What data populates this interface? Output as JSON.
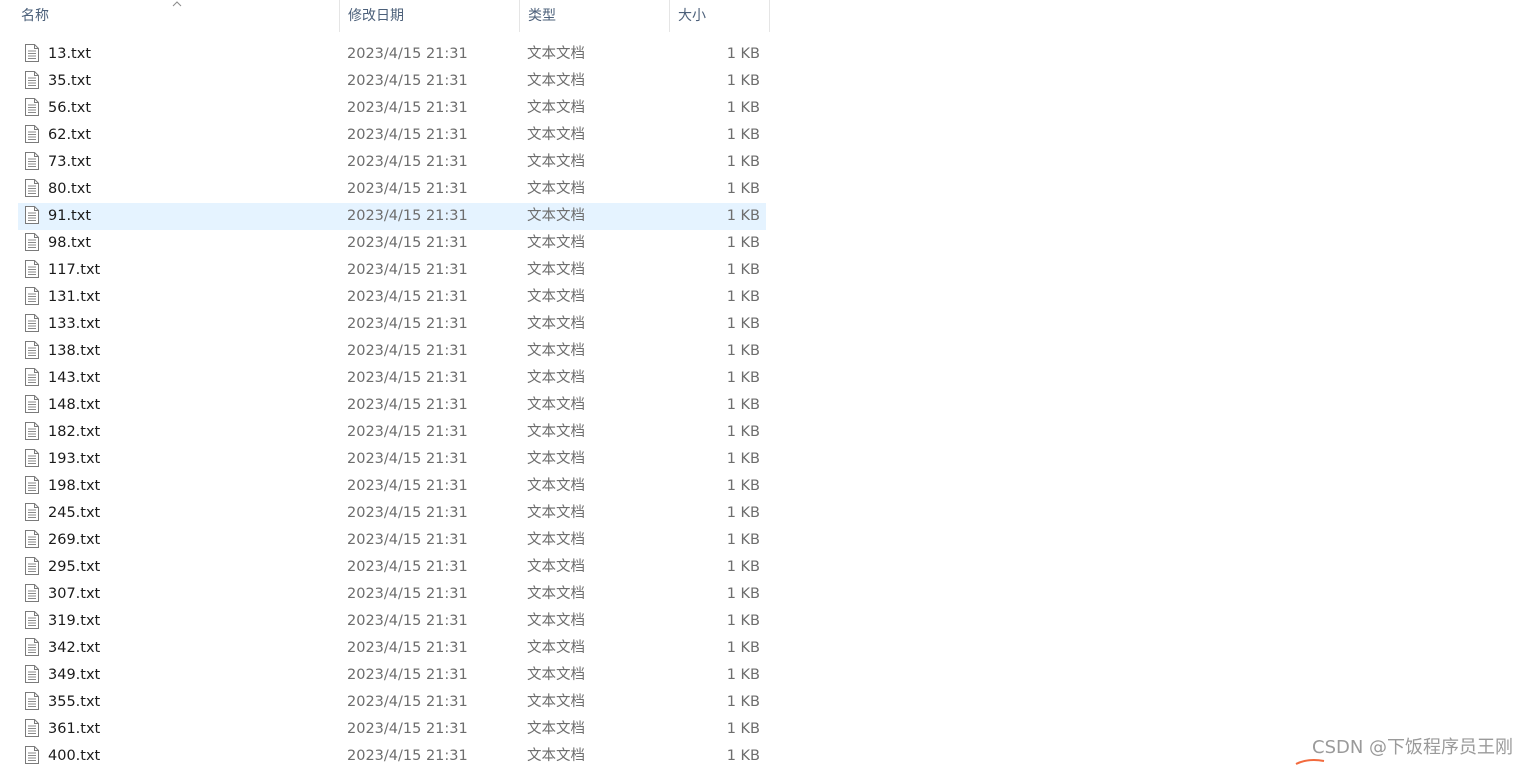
{
  "columns": {
    "name": "名称",
    "date": "修改日期",
    "type": "类型",
    "size": "大小"
  },
  "files": [
    {
      "name": "13.txt",
      "date": "2023/4/15 21:31",
      "type": "文本文档",
      "size": "1 KB"
    },
    {
      "name": "35.txt",
      "date": "2023/4/15 21:31",
      "type": "文本文档",
      "size": "1 KB"
    },
    {
      "name": "56.txt",
      "date": "2023/4/15 21:31",
      "type": "文本文档",
      "size": "1 KB"
    },
    {
      "name": "62.txt",
      "date": "2023/4/15 21:31",
      "type": "文本文档",
      "size": "1 KB"
    },
    {
      "name": "73.txt",
      "date": "2023/4/15 21:31",
      "type": "文本文档",
      "size": "1 KB"
    },
    {
      "name": "80.txt",
      "date": "2023/4/15 21:31",
      "type": "文本文档",
      "size": "1 KB"
    },
    {
      "name": "91.txt",
      "date": "2023/4/15 21:31",
      "type": "文本文档",
      "size": "1 KB",
      "selected": true
    },
    {
      "name": "98.txt",
      "date": "2023/4/15 21:31",
      "type": "文本文档",
      "size": "1 KB"
    },
    {
      "name": "117.txt",
      "date": "2023/4/15 21:31",
      "type": "文本文档",
      "size": "1 KB"
    },
    {
      "name": "131.txt",
      "date": "2023/4/15 21:31",
      "type": "文本文档",
      "size": "1 KB"
    },
    {
      "name": "133.txt",
      "date": "2023/4/15 21:31",
      "type": "文本文档",
      "size": "1 KB"
    },
    {
      "name": "138.txt",
      "date": "2023/4/15 21:31",
      "type": "文本文档",
      "size": "1 KB"
    },
    {
      "name": "143.txt",
      "date": "2023/4/15 21:31",
      "type": "文本文档",
      "size": "1 KB"
    },
    {
      "name": "148.txt",
      "date": "2023/4/15 21:31",
      "type": "文本文档",
      "size": "1 KB"
    },
    {
      "name": "182.txt",
      "date": "2023/4/15 21:31",
      "type": "文本文档",
      "size": "1 KB"
    },
    {
      "name": "193.txt",
      "date": "2023/4/15 21:31",
      "type": "文本文档",
      "size": "1 KB"
    },
    {
      "name": "198.txt",
      "date": "2023/4/15 21:31",
      "type": "文本文档",
      "size": "1 KB"
    },
    {
      "name": "245.txt",
      "date": "2023/4/15 21:31",
      "type": "文本文档",
      "size": "1 KB"
    },
    {
      "name": "269.txt",
      "date": "2023/4/15 21:31",
      "type": "文本文档",
      "size": "1 KB"
    },
    {
      "name": "295.txt",
      "date": "2023/4/15 21:31",
      "type": "文本文档",
      "size": "1 KB"
    },
    {
      "name": "307.txt",
      "date": "2023/4/15 21:31",
      "type": "文本文档",
      "size": "1 KB"
    },
    {
      "name": "319.txt",
      "date": "2023/4/15 21:31",
      "type": "文本文档",
      "size": "1 KB"
    },
    {
      "name": "342.txt",
      "date": "2023/4/15 21:31",
      "type": "文本文档",
      "size": "1 KB"
    },
    {
      "name": "349.txt",
      "date": "2023/4/15 21:31",
      "type": "文本文档",
      "size": "1 KB"
    },
    {
      "name": "355.txt",
      "date": "2023/4/15 21:31",
      "type": "文本文档",
      "size": "1 KB"
    },
    {
      "name": "361.txt",
      "date": "2023/4/15 21:31",
      "type": "文本文档",
      "size": "1 KB"
    },
    {
      "name": "400.txt",
      "date": "2023/4/15 21:31",
      "type": "文本文档",
      "size": "1 KB"
    }
  ],
  "watermark": "CSDN @下饭程序员王刚",
  "colors": {
    "selected_row": "#e5f3ff",
    "header_text": "#4c607a",
    "secondary_text": "#6d6d6d",
    "watermark_accent": "#f26a3d"
  },
  "icons": {
    "file": "text-file-icon",
    "sort": "sort-ascending-icon"
  }
}
